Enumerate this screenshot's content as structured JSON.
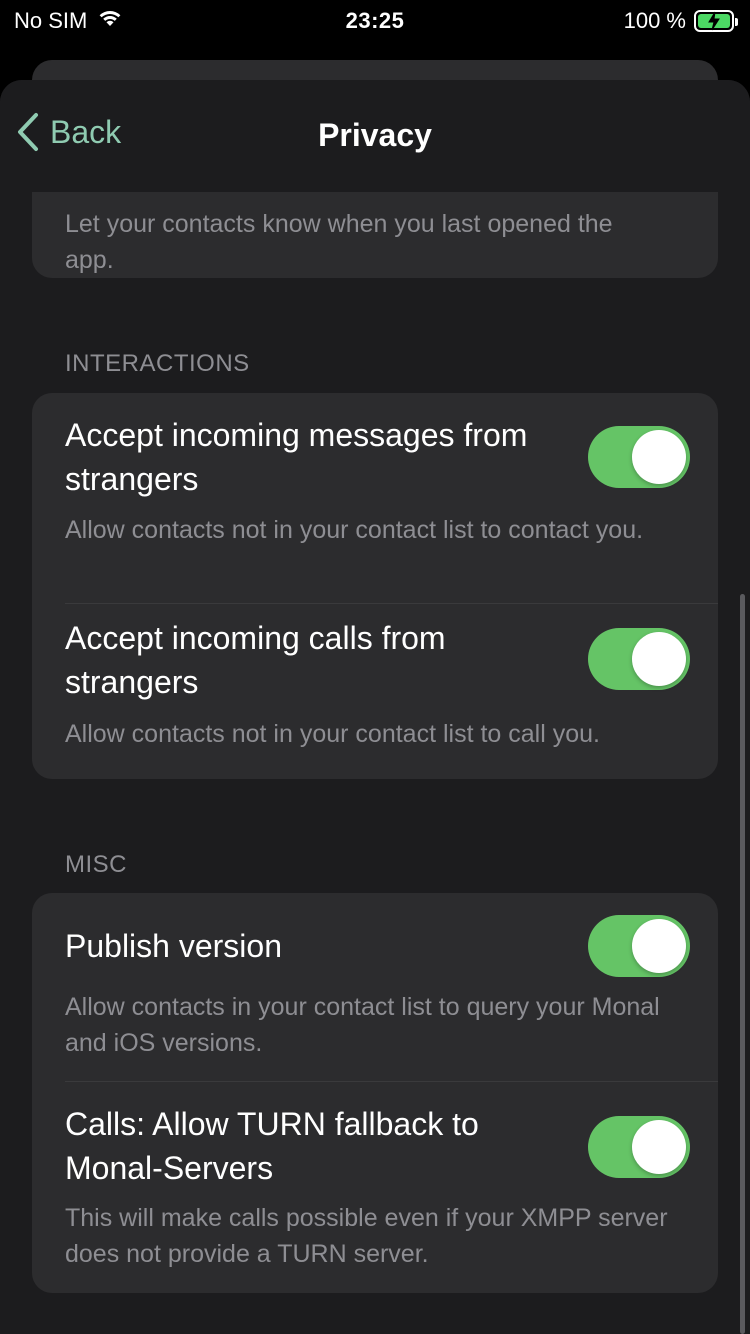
{
  "status_bar": {
    "carrier": "No SIM",
    "time": "23:25",
    "battery_percent": "100 %",
    "battery_level": 1.0
  },
  "nav": {
    "back_label": "Back",
    "title": "Privacy"
  },
  "colors": {
    "accent": "#8fcbb1",
    "toggle_on": "#65c466",
    "background": "#1c1c1e",
    "card": "#2c2c2e"
  },
  "top_card": {
    "description": "Let your contacts know when you last opened the app."
  },
  "sections": [
    {
      "header": "INTERACTIONS",
      "rows": [
        {
          "title": "Accept incoming messages from strangers",
          "description": "Allow contacts not in your contact list to contact you.",
          "enabled": true
        },
        {
          "title": "Accept incoming calls from strangers",
          "description": "Allow contacts not in your contact list to call you.",
          "enabled": true
        }
      ]
    },
    {
      "header": "MISC",
      "rows": [
        {
          "title": "Publish version",
          "description": "Allow contacts in your contact list to query your Monal and iOS versions.",
          "enabled": true
        },
        {
          "title": "Calls: Allow TURN fallback to Monal-Servers",
          "description": "This will make calls possible even if your XMPP server does not provide a TURN server.",
          "enabled": true
        }
      ]
    }
  ]
}
